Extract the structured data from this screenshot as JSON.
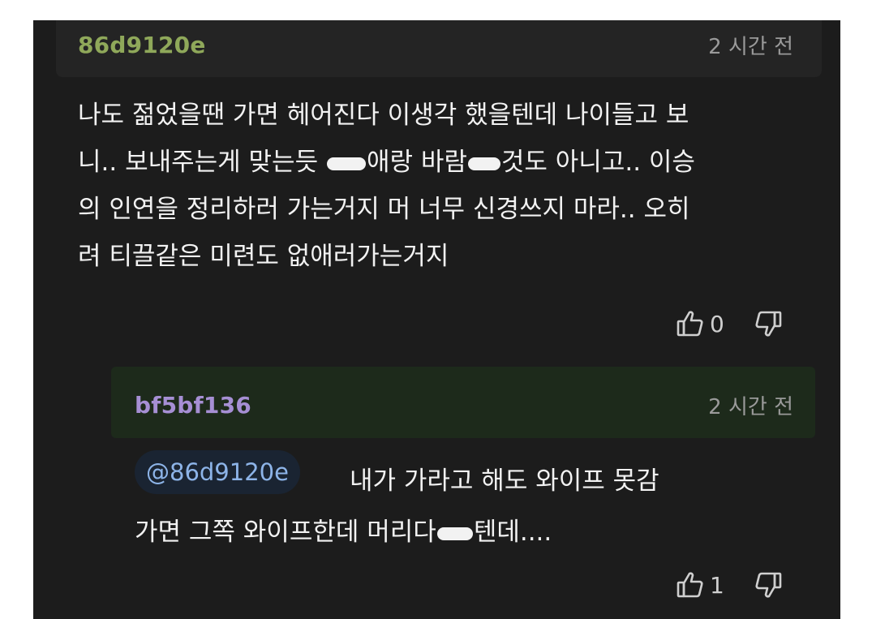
{
  "comment": {
    "username": "86d9120e",
    "time": "2 시간 전",
    "text_line1": "나도 젊었을땐 가면 헤어진다 이생각 했을텐데 나이들고 보",
    "text_line2_a": "니.. 보내주는게 맞는듯 ",
    "text_line2_b": "애랑 바람",
    "text_line2_c": "것도 아니고.. 이승",
    "text_line3": "의 인연을 정리하러 가는거지 머 너무 신경쓰지 마라.. 오히",
    "text_line4": "려 티끌같은 미련도 없애러가는거지",
    "likes": "0",
    "colors": {
      "username": "#8fa85a"
    }
  },
  "reply": {
    "username": "bf5bf136",
    "time": "2 시간 전",
    "mention": "@86d9120e",
    "text_line1": "내가 가라고 해도 와이프 못감",
    "text_line2_a": "가면 그쪽 와이프한데 머리다",
    "text_line2_b": "텐데....",
    "likes": "1",
    "colors": {
      "username": "#a68fd4",
      "mention": "#8db4e8"
    }
  },
  "icons": {
    "like": "thumbs-up-outline-icon",
    "dislike": "thumbs-down-outline-icon"
  }
}
